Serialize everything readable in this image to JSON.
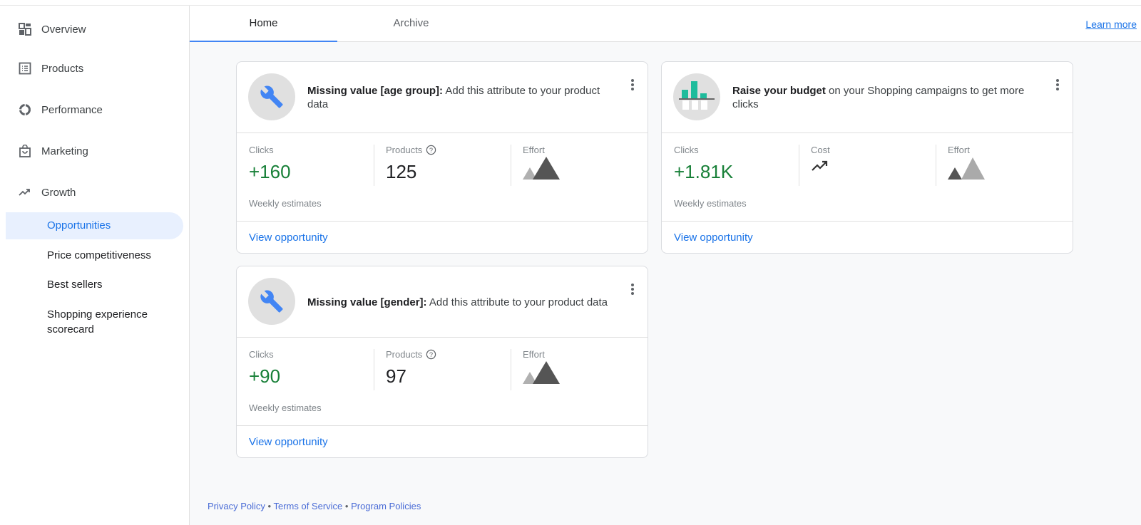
{
  "sidebar": {
    "items": [
      {
        "label": "Overview",
        "icon": "dashboard-icon"
      },
      {
        "label": "Products",
        "icon": "list-icon"
      },
      {
        "label": "Performance",
        "icon": "donut-chart-icon"
      },
      {
        "label": "Marketing",
        "icon": "shopping-bag-icon"
      },
      {
        "label": "Growth",
        "icon": "trending-up-icon"
      }
    ],
    "sub_items": [
      {
        "label": "Opportunities",
        "active": true
      },
      {
        "label": "Price competitiveness"
      },
      {
        "label": "Best sellers"
      },
      {
        "label": "Shopping experience scorecard"
      }
    ]
  },
  "tabs": [
    {
      "label": "Home",
      "active": true
    },
    {
      "label": "Archive"
    }
  ],
  "learn_more": "Learn more",
  "cards": [
    {
      "title_bold": "Missing value [age group]:",
      "title_rest": " Add this attribute to your product data",
      "icon": "wrench-icon",
      "m1_label": "Clicks",
      "m1_value": "+160",
      "m2_label": "Products",
      "m2_value": "125",
      "m3_label": "Effort",
      "weekly": "Weekly estimates",
      "link": "View opportunity"
    },
    {
      "title_bold": "Raise your budget",
      "title_rest": " on your Shopping campaigns to get more clicks",
      "icon": "budget-chart-icon",
      "m1_label": "Clicks",
      "m1_value": "+1.81K",
      "m2_label": "Cost",
      "m3_label": "Effort",
      "weekly": "Weekly estimates",
      "link": "View opportunity"
    },
    {
      "title_bold": "Missing value [gender]:",
      "title_rest": " Add this attribute to your product data",
      "icon": "wrench-icon",
      "m1_label": "Clicks",
      "m1_value": "+90",
      "m2_label": "Products",
      "m2_value": "97",
      "m3_label": "Effort",
      "weekly": "Weekly estimates",
      "link": "View opportunity"
    }
  ],
  "footer": {
    "privacy": "Privacy Policy",
    "sep": " • ",
    "terms": "Terms of Service",
    "policies": "Program Policies"
  },
  "colors": {
    "accent": "#1a73e8",
    "positive": "#188038",
    "teal": "#1ebc9c"
  }
}
